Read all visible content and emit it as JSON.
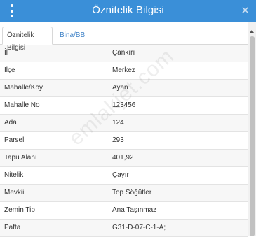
{
  "window": {
    "title": "Öznitelik Bilgisi",
    "close_glyph": "✕"
  },
  "tabs": [
    {
      "label": "Öznitelik Bilgisi",
      "active": true
    },
    {
      "label": "Bina/BB Listesi",
      "active": false
    }
  ],
  "attributes": [
    {
      "key": "İl",
      "value": "Çankırı"
    },
    {
      "key": "İlçe",
      "value": "Merkez"
    },
    {
      "key": "Mahalle/Köy",
      "value": "Ayan"
    },
    {
      "key": "Mahalle No",
      "value": "123456"
    },
    {
      "key": "Ada",
      "value": "124"
    },
    {
      "key": "Parsel",
      "value": "293"
    },
    {
      "key": "Tapu Alanı",
      "value": "401,92"
    },
    {
      "key": "Nitelik",
      "value": "Çayır"
    },
    {
      "key": "Mevkii",
      "value": "Top Söğütler"
    },
    {
      "key": "Zemin Tip",
      "value": "Ana Taşınmaz"
    },
    {
      "key": "Pafta",
      "value": "G31-D-07-C-1-A;"
    }
  ],
  "watermark": "emlakjet.com",
  "colors": {
    "titlebar": "#3a8fd8",
    "tab_link": "#3a7fc6"
  },
  "icons": {
    "menu": "kebab-menu-icon",
    "close": "close-icon",
    "scroll_up": "arrow-up-icon"
  }
}
